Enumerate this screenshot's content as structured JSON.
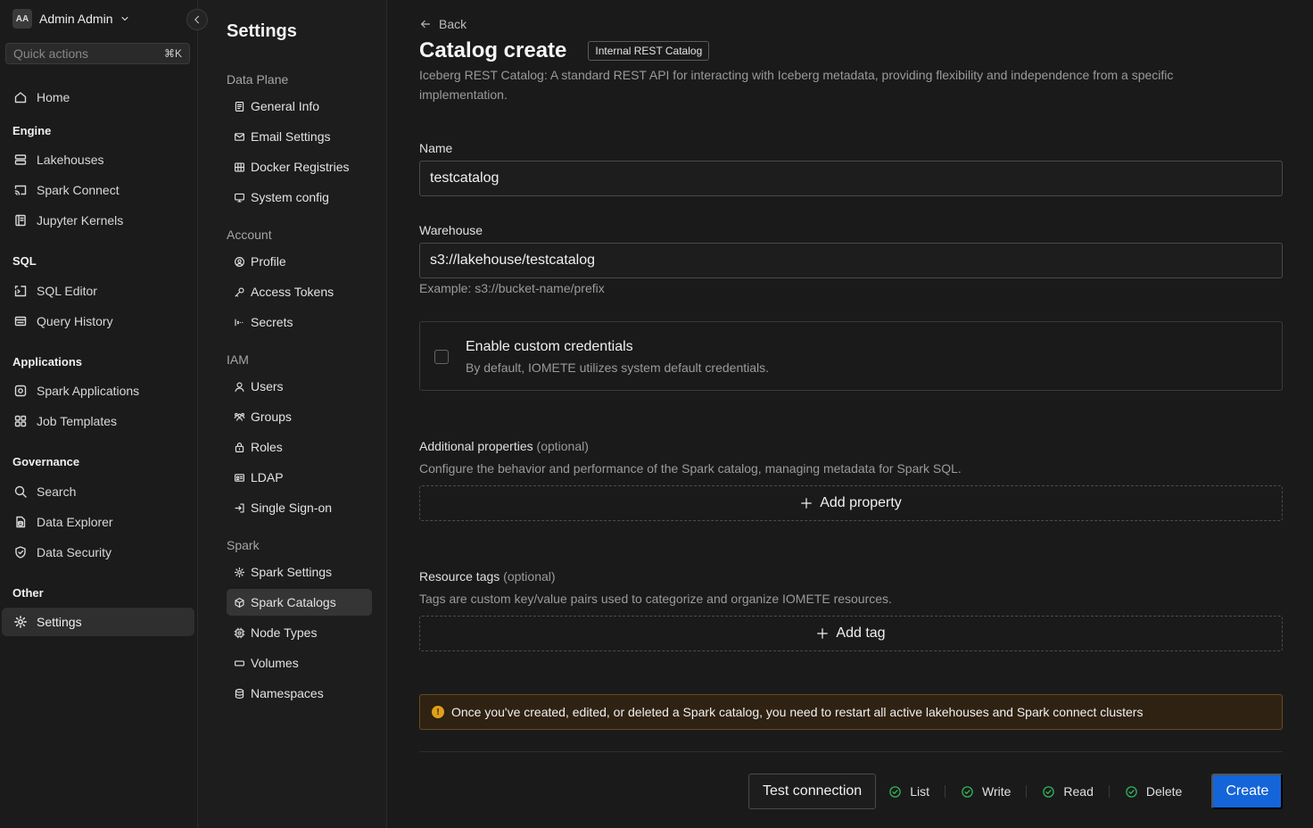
{
  "colors": {
    "primary": "#1465d9",
    "success": "#33b35a",
    "warning": "#e0a01a",
    "background": "#1b1b1b"
  },
  "nav": {
    "avatar_initials": "AA",
    "user_name": "Admin Admin",
    "quick_actions": {
      "label": "Quick actions",
      "shortcut": "⌘K"
    },
    "home": "Home",
    "groups": {
      "engine": {
        "title": "Engine",
        "items": [
          "Lakehouses",
          "Spark Connect",
          "Jupyter Kernels"
        ]
      },
      "sql": {
        "title": "SQL",
        "items": [
          "SQL Editor",
          "Query History"
        ]
      },
      "applications": {
        "title": "Applications",
        "items": [
          "Spark Applications",
          "Job Templates"
        ]
      },
      "governance": {
        "title": "Governance",
        "items": [
          "Search",
          "Data Explorer",
          "Data Security"
        ]
      },
      "other": {
        "title": "Other",
        "items": [
          "Settings"
        ]
      }
    }
  },
  "subnav": {
    "title": "Settings",
    "groups": {
      "data_plane": {
        "title": "Data Plane",
        "items": [
          "General Info",
          "Email Settings",
          "Docker Registries",
          "System config"
        ]
      },
      "account": {
        "title": "Account",
        "items": [
          "Profile",
          "Access Tokens",
          "Secrets"
        ]
      },
      "iam": {
        "title": "IAM",
        "items": [
          "Users",
          "Groups",
          "Roles",
          "LDAP",
          "Single Sign-on"
        ]
      },
      "spark": {
        "title": "Spark",
        "items": [
          "Spark Settings",
          "Spark Catalogs",
          "Node Types",
          "Volumes",
          "Namespaces"
        ]
      }
    },
    "active": "Spark Catalogs"
  },
  "main": {
    "back": "Back",
    "title": "Catalog create",
    "badge": "Internal REST Catalog",
    "description": "Iceberg REST Catalog: A standard REST API for interacting with Iceberg metadata, providing flexibility and independence from a specific implementation.",
    "name": {
      "label": "Name",
      "value": "testcatalog"
    },
    "warehouse": {
      "label": "Warehouse",
      "value": "s3://lakehouse/testcatalog",
      "hint": "Example: s3://bucket-name/prefix"
    },
    "credentials": {
      "title": "Enable custom credentials",
      "subtitle": "By default, IOMETE utilizes system default credentials.",
      "checked": false
    },
    "additional": {
      "label": "Additional properties",
      "optional": "(optional)",
      "description": "Configure the behavior and performance of the Spark catalog, managing metadata for Spark SQL.",
      "button": "Add property"
    },
    "tags": {
      "label": "Resource tags",
      "optional": "(optional)",
      "description": "Tags are custom key/value pairs used to categorize and organize IOMETE resources.",
      "button": "Add tag"
    },
    "alert": "Once you've created, edited, or deleted a Spark catalog, you need to restart all active lakehouses and Spark connect clusters",
    "alert_icon": "!",
    "footer": {
      "test_connection": "Test connection",
      "checks": [
        "List",
        "Write",
        "Read",
        "Delete"
      ],
      "create": "Create"
    }
  }
}
